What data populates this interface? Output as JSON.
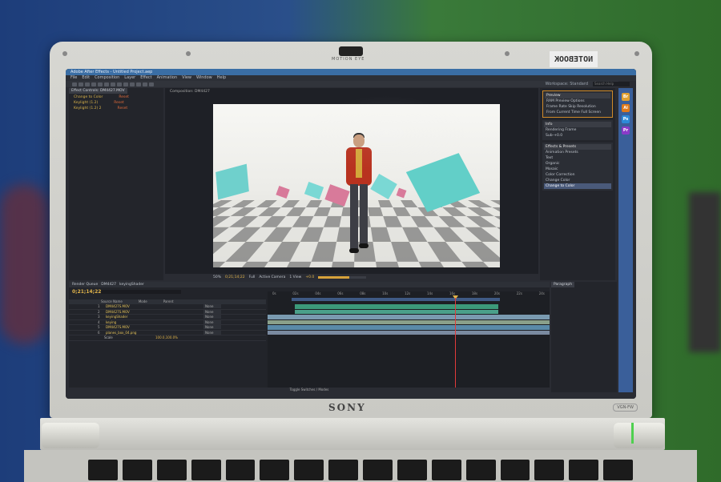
{
  "laptop": {
    "brand": "SONY",
    "camera_label": "MOTION EYE",
    "sticker_text": "NOTEBOOK",
    "model_badge": "VGN-FW"
  },
  "app": {
    "title": "Adobe After Effects - Untitled Project.aep",
    "menu": [
      "File",
      "Edit",
      "Composition",
      "Layer",
      "Effect",
      "Animation",
      "View",
      "Window",
      "Help"
    ],
    "workspace_label": "Workspace: Standard",
    "search_placeholder": "Search Help",
    "project_tab": "Effect Controls: DM4427.MOV",
    "effects": [
      {
        "name": "Change to Color",
        "action": "Reset"
      },
      {
        "name": "Keylight (1.2)",
        "action": "Reset"
      },
      {
        "name": "Keylight (1.2) 2",
        "action": "Reset"
      }
    ],
    "comp_tab": "Composition: DM4427",
    "comp_footer": {
      "zoom": "50%",
      "timecode": "0;21;14;22",
      "resolution": "Full",
      "camera": "Active Camera",
      "views": "1 View",
      "value": "+0.0",
      "progress": 0.65
    },
    "right_panels": [
      {
        "title": "Preview",
        "orange": true,
        "rows": [
          "RAM Preview Options",
          "Frame Rate  Skip  Resolution",
          "From Current Time  Full Screen"
        ]
      },
      {
        "title": "Info",
        "orange": false,
        "rows": [
          "Rendering Frame",
          "Sub-+0.0"
        ]
      },
      {
        "title": "Effects & Presets",
        "orange": false,
        "rows": [
          "Animation Presets",
          "Text",
          "Organic",
          "Mosaic",
          "Color Correction",
          "Change Color",
          "Change to Color"
        ],
        "selected_index": 6
      }
    ],
    "dock_icons": [
      {
        "name": "bridge-icon",
        "label": "Br",
        "color": "#e0a030"
      },
      {
        "name": "illustrator-icon",
        "label": "Ai",
        "color": "#e07a1a"
      },
      {
        "name": "photoshop-icon",
        "label": "Ps",
        "color": "#2d8ad8"
      },
      {
        "name": "premiere-icon",
        "label": "Pr",
        "color": "#8a3ac8"
      }
    ],
    "timeline": {
      "tabs": [
        "Render Queue",
        "DM4427",
        "keyingShader"
      ],
      "timecode": "0;21;14;22",
      "column_headers": [
        "Source Name",
        "Mode",
        "Parent"
      ],
      "layers": [
        {
          "num": "1",
          "name": "DM4427S.MOV",
          "mode": "None"
        },
        {
          "num": "2",
          "name": "DM4427S.MOV",
          "mode": "None"
        },
        {
          "num": "3",
          "name": "keyingShader",
          "mode": "None"
        },
        {
          "num": "4",
          "name": "keying",
          "mode": "None"
        },
        {
          "num": "5",
          "name": "DM4427S.MOV",
          "mode": "None"
        },
        {
          "num": "6",
          "name": "planes_box_04.png",
          "mode": "None"
        }
      ],
      "sub_property": {
        "name": "Scale",
        "value": "100.0,100.0%"
      },
      "ruler": [
        "0s",
        "02s",
        "04s",
        "06s",
        "08s",
        "10s",
        "12s",
        "14s",
        "16s",
        "18s",
        "20s",
        "22s",
        "24s"
      ],
      "footer_label": "Toggle Switches / Modes"
    },
    "paragraph_panel_title": "Paragraph"
  },
  "colors": {
    "timeline_bar_1": "#3c9a7a",
    "timeline_bar_2": "#7a9ab0",
    "timeline_bar_3": "#8aa08a",
    "timeline_bar_4": "#5a8aa8",
    "cube_teal": "#6fd0cc",
    "cube_pink": "#d87a9a"
  }
}
